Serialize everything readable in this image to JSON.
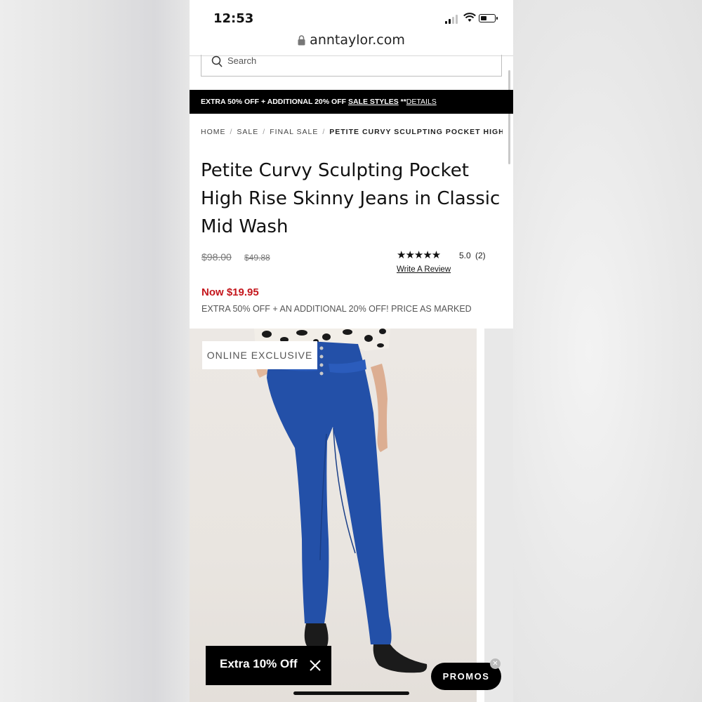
{
  "status_bar": {
    "time": "12:53"
  },
  "browser": {
    "url": "anntaylor.com"
  },
  "search": {
    "placeholder": "Search"
  },
  "promo_banner": {
    "text_prefix": "EXTRA 50% OFF + ADDITIONAL 20% OFF ",
    "link_text": "SALE STYLES",
    "separator": " **",
    "details_text": "DETAILS"
  },
  "breadcrumb": {
    "home": "HOME",
    "sale": "SALE",
    "final_sale": "FINAL SALE",
    "current": "PETITE CURVY SCULPTING POCKET HIGH …"
  },
  "product": {
    "title": "Petite Curvy Sculpting Pocket High Rise Skinny Jeans in Classic Mid Wash",
    "original_price": "$98.00",
    "sale_price": "$49.88",
    "rating_stars": "★★★★★",
    "rating_value": "5.0",
    "review_count": "(2)",
    "write_review": "Write A Review",
    "now_price": "Now $19.95",
    "promo_note": "EXTRA 50% OFF + AN ADDITIONAL 20% OFF! PRICE AS MARKED",
    "badge": "ONLINE EXCLUSIVE"
  },
  "offer_popup": {
    "label": "Extra 10% Off"
  },
  "promos_button": {
    "label": "PROMOS"
  },
  "colors": {
    "sale_red": "#c4161c",
    "denim_blue": "#2350a8",
    "banner_black": "#000000"
  }
}
